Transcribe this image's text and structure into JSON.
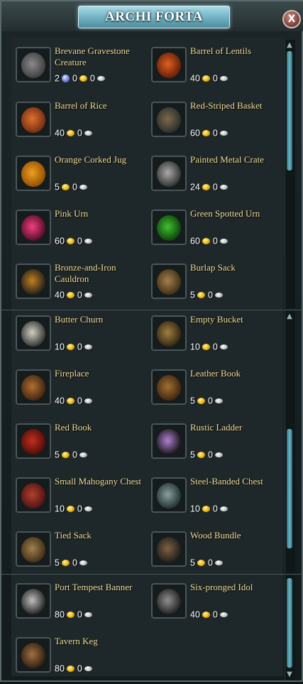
{
  "window": {
    "title": "ARCHI FORTA",
    "close_label": "X"
  },
  "items": [
    {
      "name": "Brevane Gravestone Creature",
      "gems": "2",
      "gold": "0",
      "silver": "0",
      "icon": "gravestone-icon"
    },
    {
      "name": "Barrel of Lentils",
      "gold": "40",
      "silver": "0",
      "icon": "barrel-icon"
    },
    {
      "name": "Barrel of Rice",
      "gold": "40",
      "silver": "0",
      "icon": "barrel-icon"
    },
    {
      "name": "Red-Striped Basket",
      "gold": "60",
      "silver": "0",
      "icon": "basket-icon"
    },
    {
      "name": "Orange Corked Jug",
      "gold": "5",
      "silver": "0",
      "icon": "jug-icon"
    },
    {
      "name": "Painted Metal Crate",
      "gold": "24",
      "silver": "0",
      "icon": "crate-icon"
    },
    {
      "name": "Pink Urn",
      "gold": "60",
      "silver": "0",
      "icon": "urn-icon"
    },
    {
      "name": "Green Spotted Urn",
      "gold": "60",
      "silver": "0",
      "icon": "urn-icon"
    },
    {
      "name": "Bronze-and-Iron Cauldron",
      "gold": "40",
      "silver": "0",
      "icon": "cauldron-icon"
    },
    {
      "name": "Burlap Sack",
      "gold": "5",
      "silver": "0",
      "icon": "sack-icon"
    },
    {
      "name": "Butter Churn",
      "gold": "10",
      "silver": "0",
      "icon": "churn-icon"
    },
    {
      "name": "Empty Bucket",
      "gold": "10",
      "silver": "0",
      "icon": "bucket-icon"
    },
    {
      "name": "Fireplace",
      "gold": "40",
      "silver": "0",
      "icon": "firewood-icon"
    },
    {
      "name": "Leather Book",
      "gold": "5",
      "silver": "0",
      "icon": "book-icon"
    },
    {
      "name": "Red Book",
      "gold": "5",
      "silver": "0",
      "icon": "book-icon"
    },
    {
      "name": "Rustic Ladder",
      "gold": "5",
      "silver": "0",
      "icon": "ladder-icon"
    },
    {
      "name": "Small Mahogany Chest",
      "gold": "10",
      "silver": "0",
      "icon": "chest-icon"
    },
    {
      "name": "Steel-Banded Chest",
      "gold": "10",
      "silver": "0",
      "icon": "chest-icon"
    },
    {
      "name": "Tied Sack",
      "gold": "5",
      "silver": "0",
      "icon": "sack-icon"
    },
    {
      "name": "Wood Bundle",
      "gold": "5",
      "silver": "0",
      "icon": "wood-bundle-icon"
    },
    {
      "name": "Port Tempest Banner",
      "gold": "80",
      "silver": "0",
      "icon": "banner-icon"
    },
    {
      "name": "Six-pronged Idol",
      "gold": "40",
      "silver": "0",
      "icon": "idol-icon"
    },
    {
      "name": "Tavern Keg",
      "gold": "80",
      "silver": "0",
      "icon": "keg-icon"
    }
  ],
  "colors": {
    "accent": "#79b8c8",
    "item_name": "#f0dc9a",
    "gold": "#f0c020",
    "silver": "#c8c8c8"
  }
}
